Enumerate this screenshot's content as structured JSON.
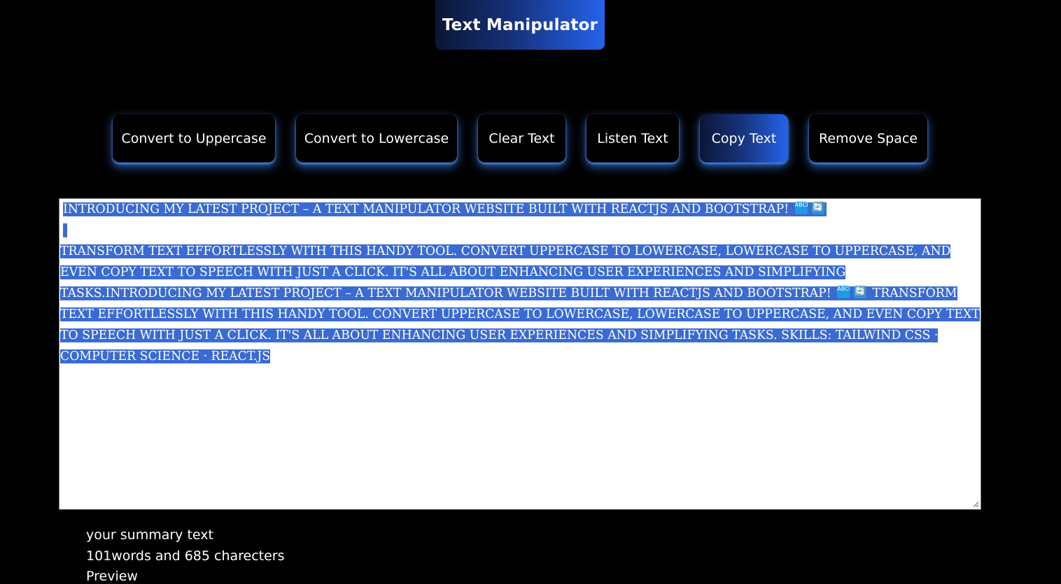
{
  "header": {
    "title": "Text Manipulator"
  },
  "toolbar": {
    "buttons": [
      {
        "label": "Convert to Uppercase"
      },
      {
        "label": "Convert to Lowercase"
      },
      {
        "label": "Clear Text"
      },
      {
        "label": "Listen Text"
      },
      {
        "label": "Copy Text",
        "active": true
      },
      {
        "label": "Remove Space"
      }
    ]
  },
  "editor": {
    "line1": "INTRODUCING MY LATEST PROJECT – A TEXT MANIPULATOR WEBSITE BUILT WITH REACTJS AND BOOTSTRAP!",
    "para2_a": "TRANSFORM TEXT EFFORTLESSLY WITH THIS HANDY TOOL. CONVERT UPPERCASE TO LOWERCASE, LOWERCASE TO UPPERCASE, AND EVEN COPY TEXT TO SPEECH WITH JUST A CLICK. IT'S ALL ABOUT ENHANCING USER EXPERIENCES AND SIMPLIFYING TASKS.INTRODUCING MY LATEST PROJECT – A TEXT MANIPULATOR WEBSITE BUILT WITH REACTJS AND BOOTSTRAP!",
    "para2_b": "TRANSFORM TEXT EFFORTLESSLY WITH THIS HANDY TOOL. CONVERT UPPERCASE TO LOWERCASE, LOWERCASE TO UPPERCASE, AND EVEN COPY TEXT TO SPEECH WITH JUST A CLICK. IT'S ALL ABOUT ENHANCING USER EXPERIENCES AND SIMPLIFYING TASKS.",
    "skills_line": "SKILLS: TAILWIND CSS · COMPUTER SCIENCE · REACT.JS",
    "emoji_abcd": "ABCD",
    "emoji_sync": "🔄"
  },
  "summary": {
    "heading": "your summary text",
    "counts": "101words and 685 charecters",
    "preview_label": "Preview"
  },
  "colors": {
    "accent": "#2563eb",
    "selection": "#3a6bd3",
    "background": "#000000"
  }
}
